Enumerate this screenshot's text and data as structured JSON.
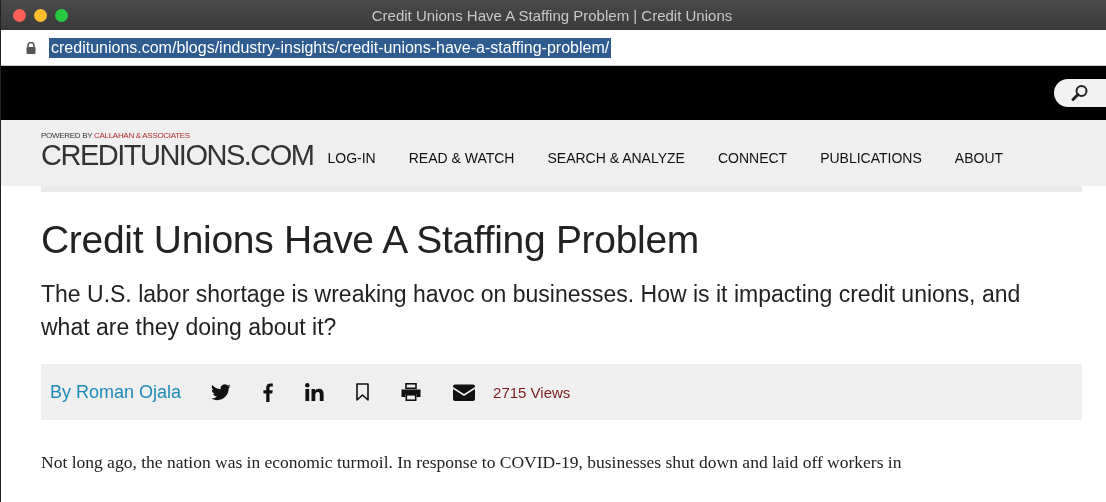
{
  "window": {
    "title": "Credit Unions Have A Staffing Problem | Credit Unions"
  },
  "address_bar": {
    "url": "creditunions.com/blogs/industry-insights/credit-unions-have-a-staffing-problem/",
    "selected": true
  },
  "logo": {
    "tagline_prefix": "POWERED BY",
    "tagline_brand": "CALLAHAN & ASSOCIATES",
    "name": "CREDITUNIONS.COM"
  },
  "nav": [
    "LOG-IN",
    "READ & WATCH",
    "SEARCH & ANALYZE",
    "CONNECT",
    "PUBLICATIONS",
    "ABOUT"
  ],
  "article": {
    "title": "Credit Unions Have A Staffing Problem",
    "subtitle": "The U.S. labor shortage is wreaking havoc on businesses. How is it impacting credit unions, and what are they doing about it?",
    "author": "By Roman Ojala",
    "share": [
      {
        "kind": "twitter"
      },
      {
        "kind": "facebook"
      },
      {
        "kind": "linkedin"
      },
      {
        "kind": "bookmark"
      },
      {
        "kind": "print"
      },
      {
        "kind": "email"
      }
    ],
    "views": "2715 Views",
    "body": "Not long ago, the nation was in economic turmoil. In response to COVID-19, businesses shut down and laid off workers in"
  }
}
